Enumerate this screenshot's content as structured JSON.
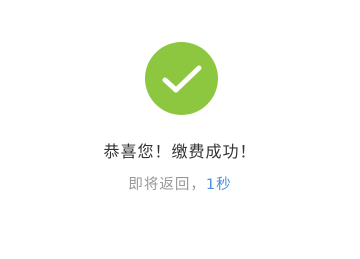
{
  "colors": {
    "success_green": "#8dc63f",
    "check_white": "#ffffff",
    "message_text": "#333333",
    "muted_text": "#999999",
    "countdown_blue": "#4a8fe0"
  },
  "icon": "checkmark-circle-icon",
  "message": "恭喜您！缴费成功！",
  "redirect": {
    "prefix": "即将返回，",
    "countdown": "1秒"
  }
}
